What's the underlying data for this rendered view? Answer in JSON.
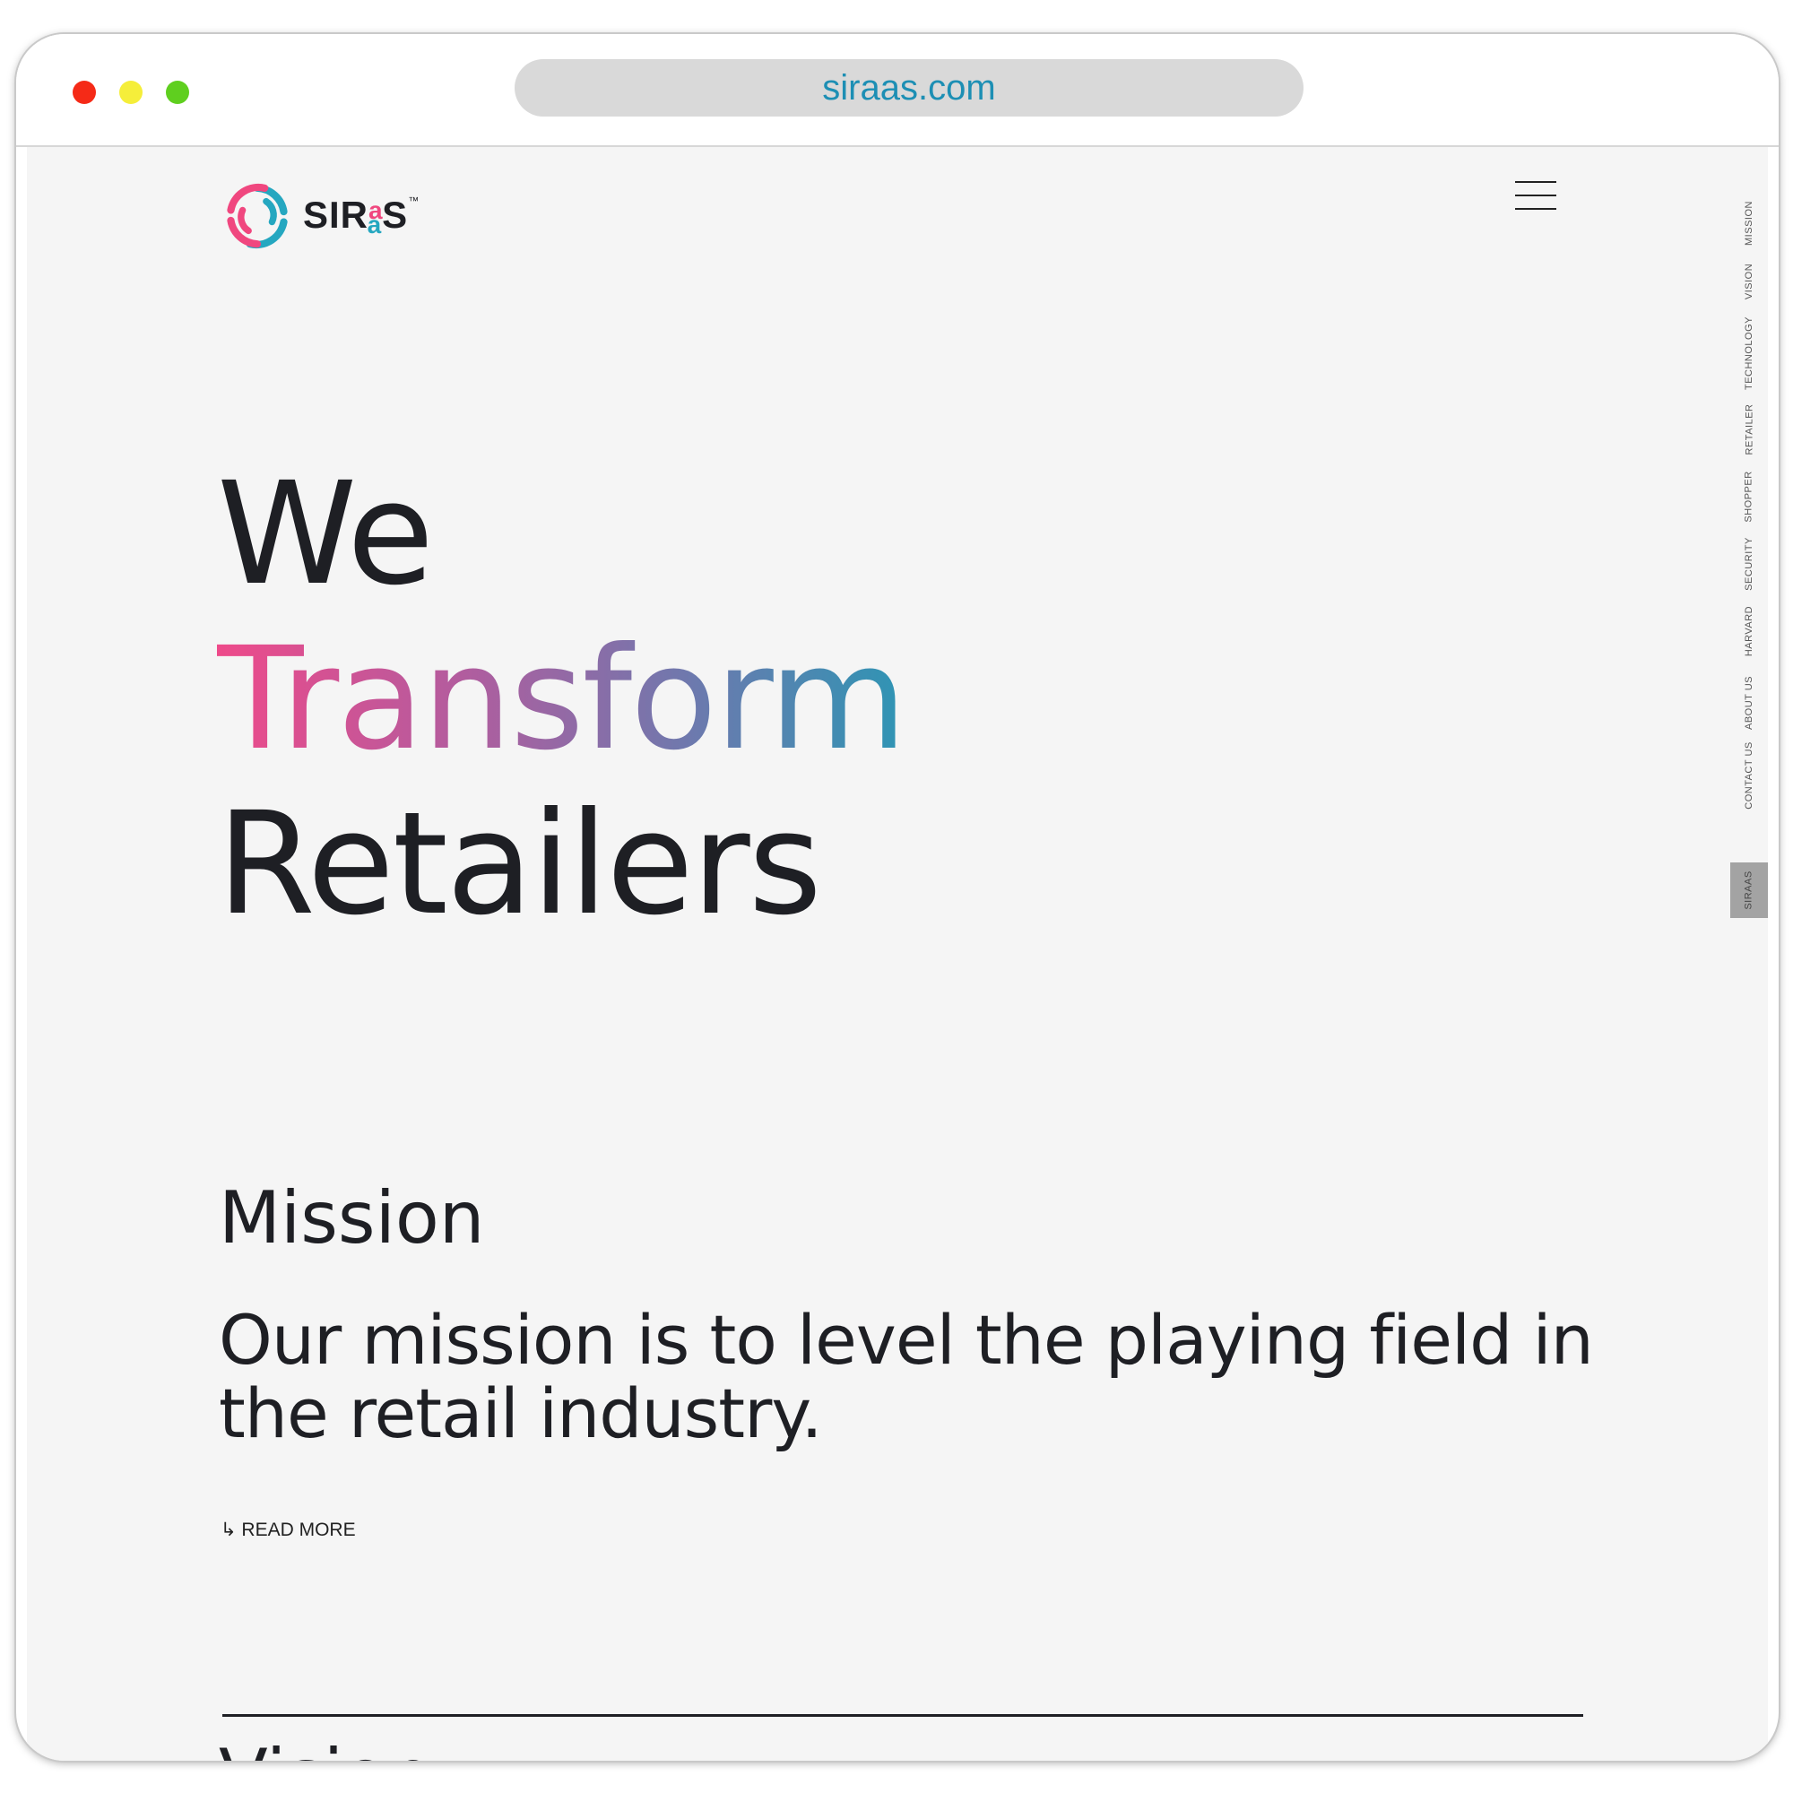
{
  "browser": {
    "url": "siraas.com"
  },
  "header": {
    "logo_text": "SIR",
    "logo_a_top": "a",
    "logo_a_bottom": "a",
    "logo_s": "S",
    "logo_tm": "™"
  },
  "hero": {
    "line1": "We",
    "line2": "Transform",
    "line3": "Retailers",
    "gradient_colors": [
      "#ee4a8a",
      "#b35c9e",
      "#6b7aae",
      "#2e95b4"
    ]
  },
  "mission": {
    "heading": "Mission",
    "text": "Our mission is to level the playing field in the retail industry.",
    "read_more": "↳ READ MORE"
  },
  "next_section": {
    "heading": "Vision"
  },
  "side_nav": {
    "items": [
      "MISSION",
      "VISION",
      "TECHNOLOGY",
      "RETAILER",
      "SHOPPER",
      "SECURITY",
      "HARVARD",
      "ABOUT US",
      "CONTACT US",
      "SIRAAS"
    ],
    "active": "SIRAAS"
  },
  "colors": {
    "text": "#1e1f24",
    "url": "#1d8fb4",
    "logo_pink": "#f0477f",
    "logo_teal": "#25a7c0",
    "page_bg": "#f5f5f5"
  }
}
